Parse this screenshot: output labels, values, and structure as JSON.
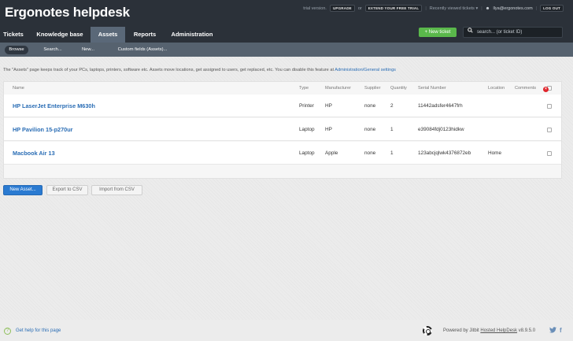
{
  "app": {
    "title": "Ergonotes helpdesk"
  },
  "topbar": {
    "trial_text": "trial version.",
    "upgrade_label": "UPGRADE",
    "or_text": "or",
    "extend_label": "EXTEND YOUR FREE TRIAL",
    "recent_label": "Recently viewed tickets ▾",
    "user_icon": "user-icon",
    "user_email": "llya@ergonotes.com",
    "logout_label": "LOG OUT"
  },
  "nav": {
    "tabs": [
      {
        "label": "Tickets"
      },
      {
        "label": "Knowledge base"
      },
      {
        "label": "Assets"
      },
      {
        "label": "Reports"
      },
      {
        "label": "Administration"
      }
    ],
    "active_tab": "Assets",
    "new_ticket_label": "+ New ticket",
    "search_placeholder": "search... (or ticket ID)"
  },
  "subnav": {
    "items": [
      {
        "label": "Browse"
      },
      {
        "label": "Search..."
      },
      {
        "label": "New..."
      },
      {
        "label": "Custom fields (Assets)..."
      }
    ],
    "active": "Browse"
  },
  "info": {
    "text": "The \"Assets\" page keeps track of your PCs, laptops, printers, software etc. Assets move locations, get assigned to users, get replaced, etc. You can disable this feature at ",
    "link": "Administration/General settings"
  },
  "table": {
    "headers": [
      "Name",
      "Type",
      "Manufacturer",
      "Supplier",
      "Quantity",
      "Serial Number",
      "Location",
      "Comments"
    ],
    "rows": [
      {
        "name": "HP LaserJet Enterprise M630h",
        "type": "Printer",
        "manufacturer": "HP",
        "supplier": "none",
        "quantity": "2",
        "serial": "11442adsfer4647frh",
        "location": "",
        "comments": ""
      },
      {
        "name": "HP Pavilion 15-p270ur",
        "type": "Laptop",
        "manufacturer": "HP",
        "supplier": "none",
        "quantity": "1",
        "serial": "e39084fdj0123hidkw",
        "location": "",
        "comments": ""
      },
      {
        "name": "Macbook Air 13",
        "type": "Laptop",
        "manufacturer": "Apple",
        "supplier": "none",
        "quantity": "1",
        "serial": "123abcjqlwk4376872eb",
        "location": "Home",
        "comments": ""
      }
    ]
  },
  "actions": {
    "new_asset": "New Asset...",
    "export_csv": "Export to CSV",
    "import_csv": "Import from CSV"
  },
  "footer": {
    "help_text": "Get help for this page",
    "powered_prefix": "Powered by Jitbit ",
    "powered_link": "Hosted HelpDesk",
    "version": " v8.9.5.0",
    "twitter_glyph": "𝕏",
    "facebook_glyph": "f"
  },
  "colors": {
    "accent": "#2a6db5",
    "topbar": "#2b3139",
    "new_ticket": "#5ab84b",
    "delete": "#e0242b"
  }
}
